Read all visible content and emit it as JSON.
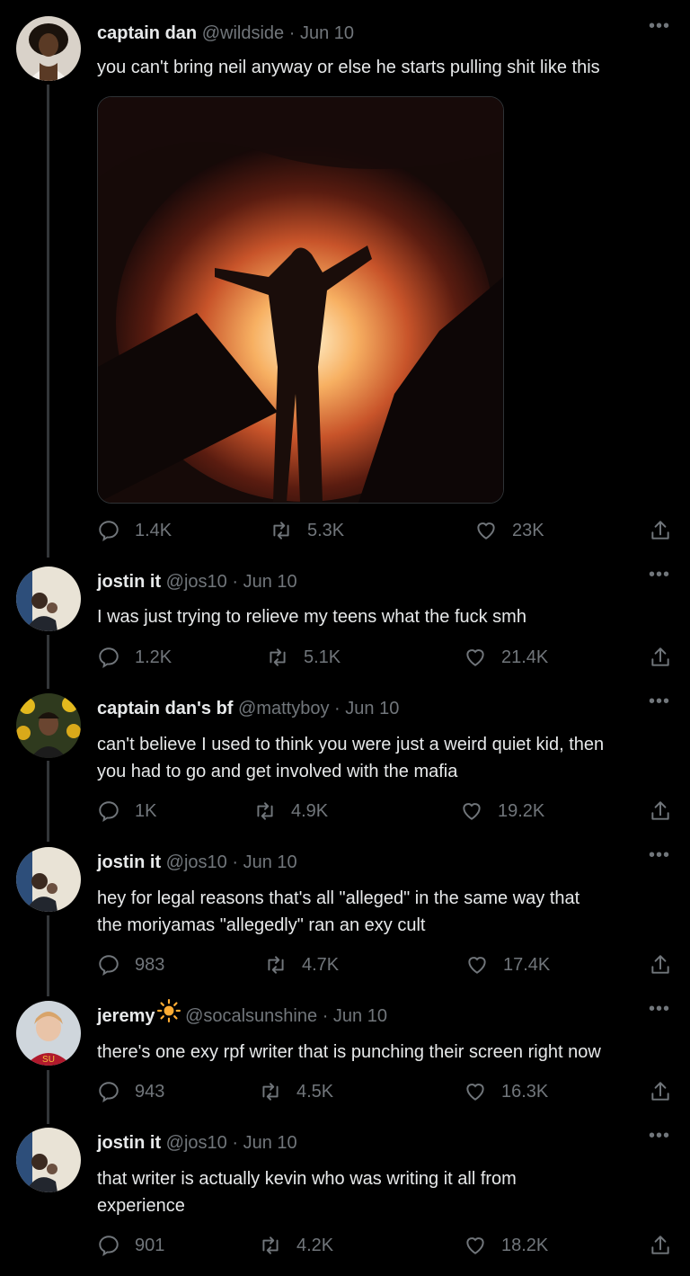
{
  "tweets": [
    {
      "name": "captain dan",
      "handle": "@wildside",
      "date": "Jun 10",
      "text": "you can't bring neil anyway or else he starts pulling shit like this",
      "has_media": true,
      "media_icon": "burning-figure-photo",
      "replies": "1.4K",
      "retweets": "5.3K",
      "likes": "23K"
    },
    {
      "name": "jostin it",
      "handle": "@jos10",
      "date": "Jun 10",
      "text": "I was just trying to relieve my teens what the fuck smh",
      "replies": "1.2K",
      "retweets": "5.1K",
      "likes": "21.4K"
    },
    {
      "name": "captain dan's bf",
      "handle": "@mattyboy",
      "date": "Jun 10",
      "text": "can't believe I used to think you were just a weird quiet kid, then\nyou had to go and get involved with the mafia",
      "replies": "1K",
      "retweets": "4.9K",
      "likes": "19.2K"
    },
    {
      "name": "jostin it",
      "handle": "@jos10",
      "date": "Jun 10",
      "text": "hey for legal reasons that's all \"alleged\" in the same way that\nthe moriyamas \"allegedly\" ran an exy cult",
      "replies": "983",
      "retweets": "4.7K",
      "likes": "17.4K"
    },
    {
      "name": "jeremy",
      "name_emoji": "sun-icon",
      "handle": "@socalsunshine",
      "date": "Jun 10",
      "text": "there's one exy rpf writer that is punching their screen right now",
      "replies": "943",
      "retweets": "4.5K",
      "likes": "16.3K"
    },
    {
      "name": "jostin it",
      "handle": "@jos10",
      "date": "Jun 10",
      "text": "that writer is actually kevin who was writing it all from\nexperience",
      "replies": "901",
      "retweets": "4.2K",
      "likes": "18.2K"
    }
  ],
  "ui": {
    "more_label": "•••",
    "separator": "·"
  },
  "colors": {
    "background": "#000000",
    "text_primary": "#e7e9ea",
    "text_secondary": "#71767b",
    "thread_line": "#333639",
    "sun": "#ffac33"
  }
}
